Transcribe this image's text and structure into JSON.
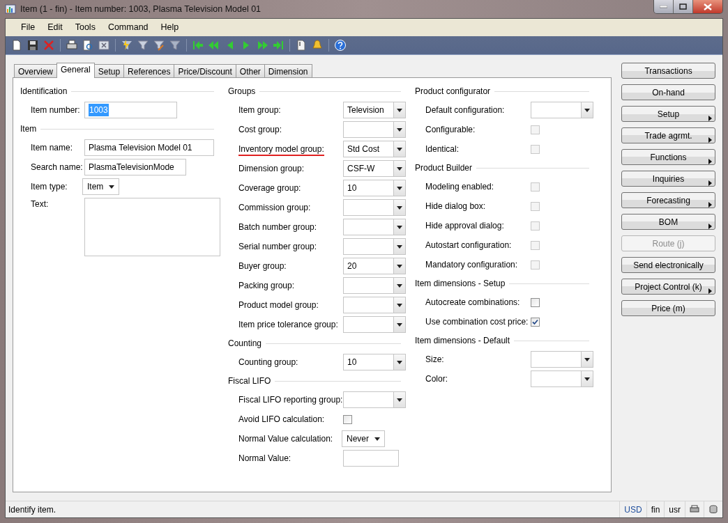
{
  "window": {
    "title": "Item (1 - fin) - Item number: 1003, Plasma Television Model 01"
  },
  "menu": [
    "File",
    "Edit",
    "Tools",
    "Command",
    "Help"
  ],
  "tabs": [
    {
      "label": "Overview",
      "selected": false
    },
    {
      "label": "General",
      "selected": true
    },
    {
      "label": "Setup",
      "selected": false
    },
    {
      "label": "References",
      "selected": false
    },
    {
      "label": "Price/Discount",
      "selected": false
    },
    {
      "label": "Other",
      "selected": false
    },
    {
      "label": "Dimension",
      "selected": false
    }
  ],
  "columns": [
    [
      {
        "title": "Identification",
        "fields": [
          {
            "label": "Item number:",
            "kind": "text",
            "value": "1003",
            "text_selected": true
          }
        ]
      },
      {
        "title": "Item",
        "fields": [
          {
            "label": "Item name:",
            "kind": "text",
            "value": "Plasma Television Model 01",
            "text_selected": false
          },
          {
            "label": "Search name:",
            "kind": "text",
            "value": "PlasmaTelevisionMode",
            "text_selected": false
          },
          {
            "label": "Item type:",
            "kind": "select",
            "value": "Item"
          },
          {
            "label": "Text:",
            "kind": "textarea"
          }
        ]
      }
    ],
    [
      {
        "title": "Groups",
        "fields": [
          {
            "label": "Item group:",
            "kind": "combo",
            "value": "Television",
            "underlined": false
          },
          {
            "label": "Cost group:",
            "kind": "combo",
            "underlined": false
          },
          {
            "label": "Inventory model group:",
            "kind": "combo",
            "value": "Std Cost",
            "underlined": true
          },
          {
            "label": "Dimension group:",
            "kind": "combo",
            "value": "CSF-W",
            "underlined": false
          },
          {
            "label": "Coverage group:",
            "kind": "combo",
            "value": "10",
            "underlined": false
          },
          {
            "label": "Commission group:",
            "kind": "combo",
            "underlined": false
          },
          {
            "label": "Batch number group:",
            "kind": "combo",
            "underlined": false
          },
          {
            "label": "Serial number group:",
            "kind": "combo",
            "underlined": false
          },
          {
            "label": "Buyer group:",
            "kind": "combo",
            "value": "20",
            "underlined": false
          },
          {
            "label": "Packing group:",
            "kind": "combo",
            "underlined": false
          },
          {
            "label": "Product model group:",
            "kind": "combo",
            "underlined": false
          },
          {
            "label": "Item price tolerance group:",
            "kind": "combo",
            "underlined": false
          }
        ]
      },
      {
        "title": "Counting",
        "fields": [
          {
            "label": "Counting group:",
            "kind": "combo",
            "value": "10"
          }
        ]
      },
      {
        "title": "Fiscal LIFO",
        "fields": [
          {
            "label": "Fiscal LIFO reporting group:",
            "kind": "combo"
          },
          {
            "label": "Avoid LIFO calculation:",
            "kind": "checkbox",
            "checked": false,
            "disabled": false
          },
          {
            "label": "Normal Value calculation:",
            "kind": "select",
            "value": "Never"
          },
          {
            "label": "Normal Value:",
            "kind": "text"
          }
        ]
      }
    ],
    [
      {
        "title": "Product configurator",
        "fields": [
          {
            "label": "Default configuration:",
            "kind": "combo"
          },
          {
            "label": "Configurable:",
            "kind": "checkbox",
            "checked": false,
            "disabled": true
          },
          {
            "label": "Identical:",
            "kind": "checkbox",
            "checked": false,
            "disabled": true
          }
        ]
      },
      {
        "title": "Product Builder",
        "fields": [
          {
            "label": "Modeling enabled:",
            "kind": "checkbox",
            "checked": false,
            "disabled": true
          },
          {
            "label": "Hide dialog box:",
            "kind": "checkbox",
            "checked": false,
            "disabled": true
          },
          {
            "label": "Hide approval dialog:",
            "kind": "checkbox",
            "checked": false,
            "disabled": true
          },
          {
            "label": "Autostart configuration:",
            "kind": "checkbox",
            "checked": false,
            "disabled": true
          },
          {
            "label": "Mandatory configuration:",
            "kind": "checkbox",
            "checked": false,
            "disabled": true
          }
        ]
      },
      {
        "title": "Item dimensions - Setup",
        "fields": [
          {
            "label": "Autocreate combinations:",
            "kind": "checkbox",
            "checked": false,
            "disabled": false
          },
          {
            "label": "Use combination cost price:",
            "kind": "checkbox",
            "checked": true,
            "disabled": false
          }
        ]
      },
      {
        "title": "Item dimensions - Default",
        "fields": [
          {
            "label": "Size:",
            "kind": "combo"
          },
          {
            "label": "Color:",
            "kind": "combo"
          }
        ]
      }
    ]
  ],
  "buttons": [
    {
      "label": "Transactions",
      "kind": "plain",
      "disabled": false
    },
    {
      "label": "On-hand",
      "kind": "plain",
      "disabled": false
    },
    {
      "label": "Setup",
      "kind": "menu",
      "disabled": false
    },
    {
      "label": "Trade agrmt.",
      "kind": "menu",
      "disabled": false
    },
    {
      "label": "Functions",
      "kind": "menu",
      "disabled": false
    },
    {
      "label": "Inquiries",
      "kind": "menu",
      "disabled": false
    },
    {
      "label": "Forecasting",
      "kind": "menu",
      "disabled": false
    },
    {
      "label": "BOM",
      "kind": "menu",
      "disabled": false
    },
    {
      "label": "Route (j)",
      "kind": "plain",
      "disabled": true
    },
    {
      "label": "Send electronically",
      "kind": "plain",
      "disabled": false
    },
    {
      "label": "Project Control (k)",
      "kind": "menu",
      "disabled": false
    },
    {
      "label": "Price (m)",
      "kind": "plain",
      "disabled": false
    }
  ],
  "status_bar": {
    "message": "Identify item.",
    "currency": "USD",
    "company": "fin",
    "layer": "usr"
  }
}
